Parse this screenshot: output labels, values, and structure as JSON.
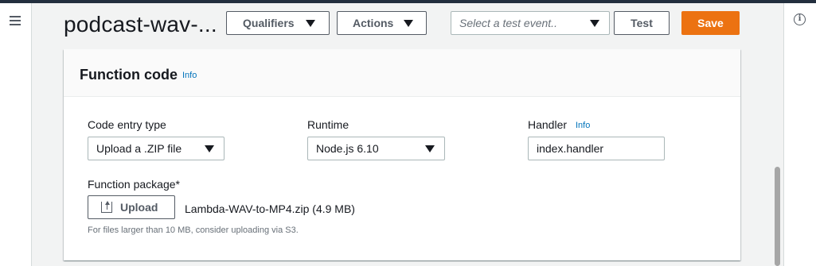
{
  "header": {
    "function_name": "podcast-wav-...",
    "qualifiers_label": "Qualifiers",
    "actions_label": "Actions",
    "test_event_placeholder": "Select a test event..",
    "test_label": "Test",
    "save_label": "Save"
  },
  "panel": {
    "title": "Function code",
    "info_link": "Info",
    "code_entry": {
      "label": "Code entry type",
      "value": "Upload a .ZIP file"
    },
    "runtime": {
      "label": "Runtime",
      "value": "Node.js 6.10"
    },
    "handler": {
      "label": "Handler",
      "info_link": "Info",
      "value": "index.handler"
    },
    "package": {
      "label": "Function package*",
      "upload_label": "Upload",
      "file_name": "Lambda-WAV-to-MP4.zip (4.9 MB)",
      "hint": "For files larger than 10 MB, consider uploading via S3."
    }
  },
  "icons": {
    "menu": "menu-icon",
    "info": "info-circle-icon",
    "upload": "upload-icon",
    "caret": "caret-down-icon"
  },
  "colors": {
    "accent": "#ec7211",
    "link": "#0073bb",
    "nav_bar": "#232f3e"
  }
}
